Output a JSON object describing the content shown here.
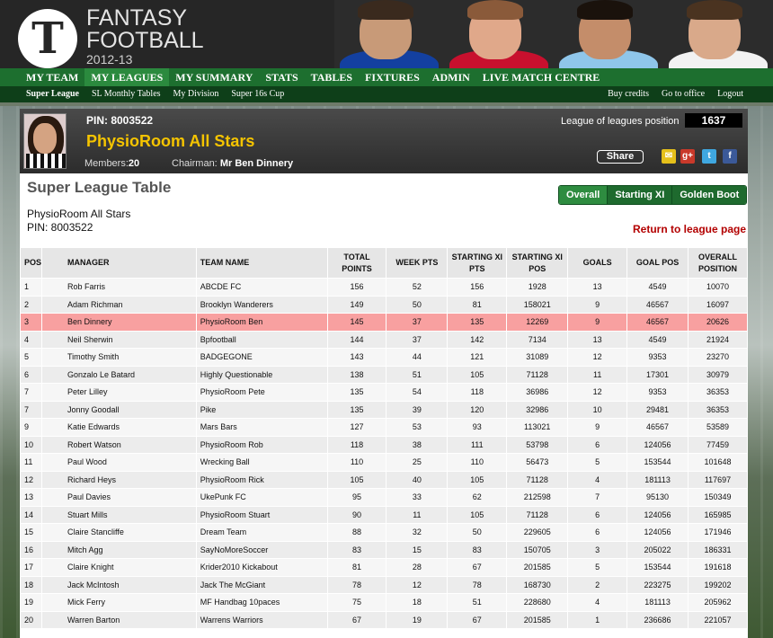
{
  "brand": {
    "logo_letter": "T",
    "line1": "FANTASY",
    "line2": "FOOTBALL",
    "line3": "2012-13"
  },
  "nav": {
    "main": [
      "MY TEAM",
      "MY LEAGUES",
      "MY SUMMARY",
      "STATS",
      "TABLES",
      "FIXTURES",
      "ADMIN",
      "LIVE MATCH CENTRE"
    ],
    "sub_left": [
      "Super League",
      "SL Monthly Tables",
      "My Division",
      "Super 16s Cup"
    ],
    "sub_right": [
      "Buy credits",
      "Go to office",
      "Logout"
    ]
  },
  "league": {
    "pin": "PIN: 8003522",
    "name": "PhysioRoom All Stars",
    "members_label": "Members:",
    "members": "20",
    "chairman_label": "Chairman:",
    "chairman": "Mr Ben Dinnery",
    "lol_label": "League of leagues position",
    "lol_value": "1637",
    "share": "Share"
  },
  "colors": {
    "green": "#1d6f2f",
    "dark_green": "#0e3f19",
    "highlight": "#f8a0a0",
    "gold": "#f5c400"
  },
  "section": {
    "title": "Super League Table",
    "tabs": [
      "Overall",
      "Starting XI",
      "Golden Boot"
    ],
    "league_name": "PhysioRoom All Stars",
    "pin": "PIN: 8003522",
    "return": "Return to league page"
  },
  "table": {
    "headers": [
      "POS",
      "MANAGER",
      "TEAM NAME",
      "TOTAL POINTS",
      "WEEK PTS",
      "STARTING XI PTS",
      "STARTING XI POS",
      "GOALS",
      "GOAL POS",
      "OVERALL POSITION"
    ],
    "rows": [
      [
        "1",
        "Rob Farris",
        "ABCDE FC",
        "156",
        "52",
        "156",
        "1928",
        "13",
        "4549",
        "10070"
      ],
      [
        "2",
        "Adam Richman",
        "Brooklyn Wanderers",
        "149",
        "50",
        "81",
        "158021",
        "9",
        "46567",
        "16097"
      ],
      [
        "3",
        "Ben Dinnery",
        "PhysioRoom Ben",
        "145",
        "37",
        "135",
        "12269",
        "9",
        "46567",
        "20626"
      ],
      [
        "4",
        "Neil Sherwin",
        "Bpfootball",
        "144",
        "37",
        "142",
        "7134",
        "13",
        "4549",
        "21924"
      ],
      [
        "5",
        "Timothy Smith",
        "BADGEGONE",
        "143",
        "44",
        "121",
        "31089",
        "12",
        "9353",
        "23270"
      ],
      [
        "6",
        "Gonzalo Le Batard",
        "Highly Questionable",
        "138",
        "51",
        "105",
        "71128",
        "11",
        "17301",
        "30979"
      ],
      [
        "7",
        "Peter Lilley",
        "PhysioRoom Pete",
        "135",
        "54",
        "118",
        "36986",
        "12",
        "9353",
        "36353"
      ],
      [
        "7",
        "Jonny Goodall",
        "Pike",
        "135",
        "39",
        "120",
        "32986",
        "10",
        "29481",
        "36353"
      ],
      [
        "9",
        "Katie Edwards",
        "Mars Bars",
        "127",
        "53",
        "93",
        "113021",
        "9",
        "46567",
        "53589"
      ],
      [
        "10",
        "Robert Watson",
        "PhysioRoom Rob",
        "118",
        "38",
        "111",
        "53798",
        "6",
        "124056",
        "77459"
      ],
      [
        "11",
        "Paul Wood",
        "Wrecking Ball",
        "110",
        "25",
        "110",
        "56473",
        "5",
        "153544",
        "101648"
      ],
      [
        "12",
        "Richard Heys",
        "PhysioRoom Rick",
        "105",
        "40",
        "105",
        "71128",
        "4",
        "181113",
        "117697"
      ],
      [
        "13",
        "Paul Davies",
        "UkePunk FC",
        "95",
        "33",
        "62",
        "212598",
        "7",
        "95130",
        "150349"
      ],
      [
        "14",
        "Stuart Mills",
        "PhysioRoom Stuart",
        "90",
        "11",
        "105",
        "71128",
        "6",
        "124056",
        "165985"
      ],
      [
        "15",
        "Claire Stancliffe",
        "Dream Team",
        "88",
        "32",
        "50",
        "229605",
        "6",
        "124056",
        "171946"
      ],
      [
        "16",
        "Mitch Agg",
        "SayNoMoreSoccer",
        "83",
        "15",
        "83",
        "150705",
        "3",
        "205022",
        "186331"
      ],
      [
        "17",
        "Claire Knight",
        "Krider2010 Kickabout",
        "81",
        "28",
        "67",
        "201585",
        "5",
        "153544",
        "191618"
      ],
      [
        "18",
        "Jack McIntosh",
        "Jack The McGiant",
        "78",
        "12",
        "78",
        "168730",
        "2",
        "223275",
        "199202"
      ],
      [
        "19",
        "Mick Ferry",
        "MF Handbag 10paces",
        "75",
        "18",
        "51",
        "228680",
        "4",
        "181113",
        "205962"
      ],
      [
        "20",
        "Warren Barton",
        "Warrens Warriors",
        "67",
        "19",
        "67",
        "201585",
        "1",
        "236686",
        "221057"
      ]
    ]
  }
}
